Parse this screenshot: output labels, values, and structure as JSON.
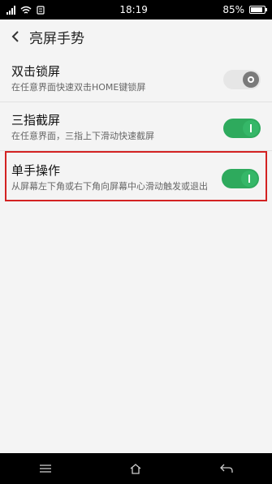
{
  "status": {
    "time": "18:19",
    "battery": "85%",
    "battery_level": 0.85
  },
  "header": {
    "title": "亮屏手势"
  },
  "settings": [
    {
      "title": "双击锁屏",
      "desc": "在任意界面快速双击HOME键锁屏",
      "enabled": false
    },
    {
      "title": "三指截屏",
      "desc": "在任意界面，三指上下滑动快速截屏",
      "enabled": true
    },
    {
      "title": "单手操作",
      "desc": "从屏幕左下角或右下角向屏幕中心滑动触发或退出",
      "enabled": true
    }
  ],
  "icons": {
    "back": "chevron-left-icon",
    "menu": "menu-icon",
    "home": "home-icon",
    "return": "return-icon"
  },
  "colors": {
    "toggle_on": "#2eaa5d",
    "highlight": "#d32222"
  }
}
